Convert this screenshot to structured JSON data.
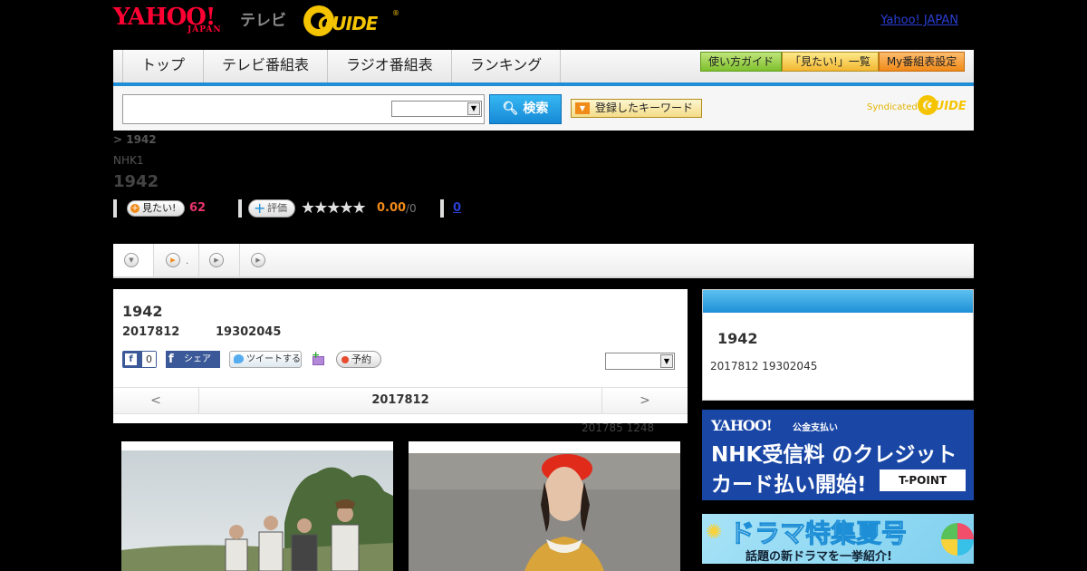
{
  "header": {
    "yahoo_logo": "YAHOO!",
    "yahoo_japan": "JAPAN",
    "tv_label": "テレビ",
    "gguide_logo": "GUIDE",
    "gguide_reg": "®",
    "yj_link": "Yahoo! JAPAN"
  },
  "nav": {
    "tabs": [
      "トップ",
      "テレビ番組表",
      "ラジオ番組表",
      "ランキング"
    ],
    "buttons": [
      "使い方ガイド",
      "「見たい!」一覧",
      "My番組表設定"
    ]
  },
  "search": {
    "button_label": "検索",
    "keyword_button": "登録したキーワード",
    "syndicated_label": "Syndicated",
    "syndicated_logo": "GUIDE"
  },
  "breadcrumb": "> 1942",
  "channel": "NHK1",
  "program_title": "1942",
  "actions": {
    "want_label": "見たい!",
    "want_count": "62",
    "rate_label": "評価",
    "stars": "★★★★★",
    "score": "0.00",
    "score_max": "/0",
    "review_count": "0"
  },
  "tabstrip": {
    "dot": "."
  },
  "card": {
    "title": "1942",
    "date": "2017812",
    "time": "19302045",
    "fb_like_count": "0",
    "fb_share": "シェア",
    "tweet": "ツイートする",
    "reserve": "予約",
    "nav_prev": "<",
    "nav_current": "2017812",
    "nav_next": ">"
  },
  "update_note": "201785  1248",
  "side": {
    "title": "1942",
    "date": "2017812  19302045"
  },
  "ad1": {
    "logo": "YAHOO!",
    "pay": "公金支払い",
    "line1": "NHK受信料 のクレジット",
    "line2": "カード払い開始!",
    "tpoint": "T-POINT"
  },
  "ad2": {
    "title": "ドラマ特集夏号",
    "subtitle": "話題の新ドラマを一挙紹介!"
  },
  "colors": {
    "accent": "#1e8fd6",
    "brand_red": "#ff0033",
    "gguide_yellow": "#f5c400",
    "want_pink": "#e8336b",
    "score_orange": "#f08a18"
  }
}
